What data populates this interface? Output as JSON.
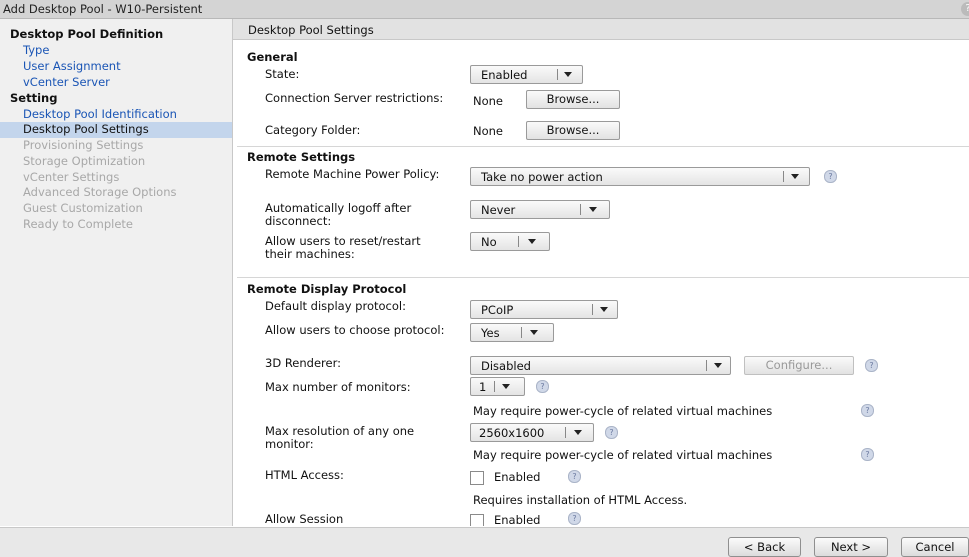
{
  "window": {
    "title": "Add Desktop Pool - W10-Persistent",
    "help_glyph": "?"
  },
  "sidebar": {
    "items": [
      {
        "label": "Desktop Pool Definition",
        "state": "heading"
      },
      {
        "label": "Type",
        "state": "link"
      },
      {
        "label": "User Assignment",
        "state": "link"
      },
      {
        "label": "vCenter Server",
        "state": "link"
      },
      {
        "label": "Setting",
        "state": "heading"
      },
      {
        "label": "Desktop Pool Identification",
        "state": "link"
      },
      {
        "label": "Desktop Pool Settings",
        "state": "selected"
      },
      {
        "label": "Provisioning Settings",
        "state": "disabled"
      },
      {
        "label": "Storage Optimization",
        "state": "disabled"
      },
      {
        "label": "vCenter Settings",
        "state": "disabled"
      },
      {
        "label": "Advanced Storage Options",
        "state": "disabled"
      },
      {
        "label": "Guest Customization",
        "state": "disabled"
      },
      {
        "label": "Ready to Complete",
        "state": "disabled"
      }
    ]
  },
  "header": {
    "title": "Desktop Pool Settings"
  },
  "general": {
    "title": "General",
    "state_label": "State:",
    "state_value": "Enabled",
    "conn_label": "Connection Server restrictions:",
    "conn_value": "None",
    "browse_label": "Browse...",
    "category_label": "Category Folder:",
    "category_value": "None"
  },
  "remote": {
    "title": "Remote Settings",
    "power_label": "Remote Machine Power Policy:",
    "power_value": "Take no power action",
    "logoff_label": "Automatically logoff after disconnect:",
    "logoff_value": "Never",
    "reset_label": "Allow users to reset/restart their machines:",
    "reset_value": "No"
  },
  "display": {
    "title": "Remote Display Protocol",
    "default_label": "Default display protocol:",
    "default_value": "PCoIP",
    "choose_label": "Allow users to choose protocol:",
    "choose_value": "Yes",
    "renderer_label": "3D Renderer:",
    "renderer_value": "Disabled",
    "configure_label": "Configure...",
    "monitors_label": "Max number of monitors:",
    "monitors_value": "1",
    "power_cycle_note": "May require power-cycle of related virtual machines",
    "resolution_label": "Max resolution of any one monitor:",
    "resolution_value": "2560x1600",
    "html_label": "HTML Access:",
    "enabled_label": "Enabled",
    "html_note": "Requires installation of HTML Access.",
    "session_label": "Allow Session"
  },
  "footer": {
    "back_label": "< Back",
    "next_label": "Next >",
    "cancel_label": "Cancel"
  },
  "colors": {
    "selected_bg": "#c3d5ec",
    "link": "#1a55b5",
    "disabled_text": "#a8a8a8"
  }
}
